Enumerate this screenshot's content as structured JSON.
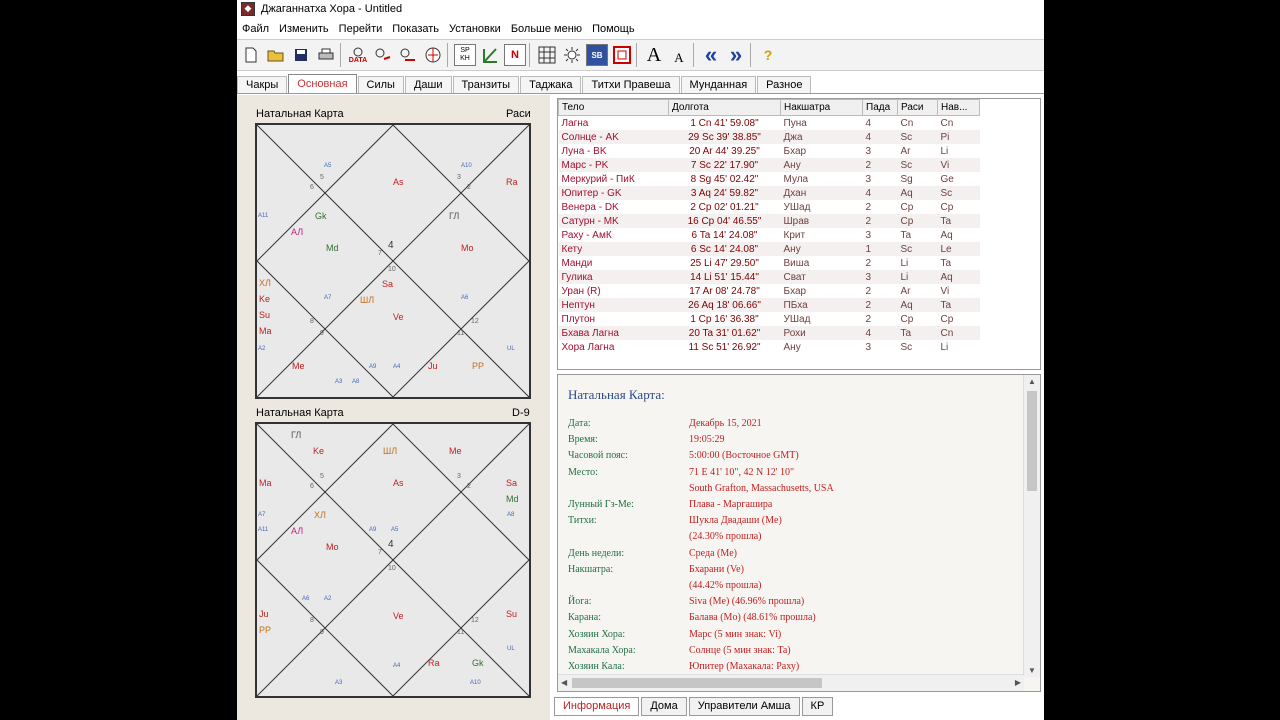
{
  "window": {
    "title": "Джаганнатха Хора - Untitled"
  },
  "menu": [
    "Файл",
    "Изменить",
    "Перейти",
    "Показать",
    "Установки",
    "Больше меню",
    "Помощь"
  ],
  "toolbar": {
    "data_label": "DATA",
    "sp_label": "SP",
    "kh_label": "KH",
    "n_label": "N",
    "sb_label": "SB",
    "font_big": "A",
    "font_small": "A",
    "prev": "«",
    "next": "»",
    "help": "?"
  },
  "tabs": [
    "Чакры",
    "Основная",
    "Силы",
    "Даши",
    "Транзиты",
    "Таджака",
    "Титхи Правеша",
    "Мунданная",
    "Разное"
  ],
  "rasi_chart": {
    "title": "Натальная Карта",
    "type": "Раси",
    "center": "4",
    "labels": {
      "as": "As",
      "ra": "Ra",
      "gk": "Gk",
      "gl": "ГЛ",
      "al": "АЛ",
      "md": "Md",
      "mo": "Mo",
      "hl": "ХЛ",
      "ke": "Ke",
      "su": "Su",
      "ma": "Ma",
      "sa": "Sa",
      "shl": "ШЛ",
      "ve": "Ve",
      "me": "Me",
      "ju": "Ju",
      "pp": "PP",
      "a5": "A5",
      "a10": "A10",
      "a11": "A11",
      "a7": "A7",
      "a6": "A6",
      "a2": "A2",
      "a3": "A3",
      "a8": "A8",
      "a9": "A9",
      "a4": "A4",
      "ul": "UL",
      "n1": "4",
      "n2": "5",
      "n3": "6",
      "n4": "3",
      "n5": "2",
      "n6": "7",
      "n7": "10",
      "n8": "8",
      "n9": "9",
      "n10": "11",
      "n11": "12",
      "n12": "1"
    }
  },
  "navamsa_chart": {
    "title": "Натальная Карта",
    "type": "D-9",
    "center": "4",
    "labels": {
      "gl": "ГЛ",
      "ke": "Ke",
      "shl": "ШЛ",
      "me": "Me",
      "as": "As",
      "sa": "Sa",
      "md": "Md",
      "ma": "Ma",
      "hl": "ХЛ",
      "al": "АЛ",
      "mo": "Mo",
      "ve": "Ve",
      "ju": "Ju",
      "pp": "PP",
      "su": "Su",
      "ra": "Ra",
      "gk": "Gk",
      "a7": "A7",
      "a11": "A11",
      "a9": "A9",
      "a5": "A5",
      "a8": "A8",
      "a6": "A6",
      "a2": "A2",
      "a4": "A4",
      "a3": "A3",
      "a10": "A10",
      "ul": "UL",
      "n1": "4",
      "n2": "5",
      "n3": "6",
      "n4": "3",
      "n5": "2",
      "n6": "7",
      "n7": "10",
      "n8": "8",
      "n9": "9",
      "n10": "11",
      "n11": "12",
      "n12": "1"
    }
  },
  "planet_table": {
    "headers": [
      "Тело",
      "Долгота",
      "Накшатра",
      "Пада",
      "Раси",
      "Нав..."
    ],
    "rows": [
      [
        "Лагна",
        "1 Cn 41' 59.08\"",
        "Пуна",
        "4",
        "Cn",
        "Cn"
      ],
      [
        "Солнце - AK",
        "29 Sc 39' 38.85\"",
        "Джа",
        "4",
        "Sc",
        "Pi"
      ],
      [
        "Луна - BK",
        "20 Ar 44' 39.25\"",
        "Бхар",
        "3",
        "Ar",
        "Li"
      ],
      [
        "Марс - PK",
        "7 Sc 22' 17.90\"",
        "Ану",
        "2",
        "Sc",
        "Vi"
      ],
      [
        "Меркурий - ПиК",
        "8 Sg 45' 02.42\"",
        "Мула",
        "3",
        "Sg",
        "Ge"
      ],
      [
        "Юпитер - GK",
        "3 Aq 24' 59.82\"",
        "Дхан",
        "4",
        "Aq",
        "Sc"
      ],
      [
        "Венера - DK",
        "2 Cp 02' 01.21\"",
        "УШад",
        "2",
        "Cp",
        "Cp"
      ],
      [
        "Сатурн - MK",
        "16 Cp 04' 46.55\"",
        "Шрав",
        "2",
        "Cp",
        "Ta"
      ],
      [
        "Раху - АмК",
        "6 Ta 14' 24.08\"",
        "Крит",
        "3",
        "Ta",
        "Aq"
      ],
      [
        "Кету",
        "6 Sc 14' 24.08\"",
        "Ану",
        "1",
        "Sc",
        "Le"
      ],
      [
        "Мaнди",
        "25 Li 47' 29.50\"",
        "Виша",
        "2",
        "Li",
        "Ta"
      ],
      [
        "Гулика",
        "14 Li 51' 15.44\"",
        "Сват",
        "3",
        "Li",
        "Aq"
      ],
      [
        "Уран (R)",
        "17 Ar 08' 24.78\"",
        "Бхар",
        "2",
        "Ar",
        "Vi"
      ],
      [
        "Нептун",
        "26 Aq 18' 06.66\"",
        "ПБха",
        "2",
        "Aq",
        "Ta"
      ],
      [
        "Плутон",
        "1 Cp 16' 36.38\"",
        "УШад",
        "2",
        "Cp",
        "Cp"
      ],
      [
        "Бхава Лагна",
        "20 Ta 31' 01.62\"",
        "Рохи",
        "4",
        "Ta",
        "Cn"
      ],
      [
        "Хора Лагна",
        "11 Sc 51' 26.92\"",
        "Ану",
        "3",
        "Sc",
        "Li"
      ]
    ]
  },
  "info": {
    "title": "Натальная Карта:",
    "rows": [
      {
        "label": "Дата:",
        "value": "Декабрь 15, 2021"
      },
      {
        "label": "Время:",
        "value": "19:05:29"
      },
      {
        "label": "Часовой пояс:",
        "value": "5:00:00 (Восточное GMT)"
      },
      {
        "label": "Место:",
        "value": "71 E 41' 10\", 42 N 12' 10\""
      },
      {
        "label": "",
        "value": "South Grafton, Massachusetts, USA"
      },
      {
        "label": "Лунный Гз-Ме:",
        "value": "Плава - Маргашира"
      },
      {
        "label": "Титхи:",
        "value": "Шукла Двадаши (Me)"
      },
      {
        "label": "",
        "value": " (24.30% прошла)"
      },
      {
        "label": "День недели:",
        "value": "Среда (Me)"
      },
      {
        "label": "Накшатра:",
        "value": "Бхарани (Ve)"
      },
      {
        "label": "",
        "value": " (44.42% прошла)"
      },
      {
        "label": "Йога:",
        "value": "Siva (Me) (46.96% прошла)"
      },
      {
        "label": "Карана:",
        "value": "Балава (Mo) (48.61% прошла)"
      },
      {
        "label": "Хозяин Хора:",
        "value": "Марс (5 мин знак: Vi)"
      },
      {
        "label": "Махакала Хора:",
        "value": "Солнце (5 мин знак: Ta)"
      },
      {
        "label": "Хозяин Кала:",
        "value": "Юпитер (Махакала: Раху)"
      }
    ]
  },
  "bottom_tabs": [
    "Информация",
    "Дома",
    "Управители Амша",
    "КР"
  ]
}
